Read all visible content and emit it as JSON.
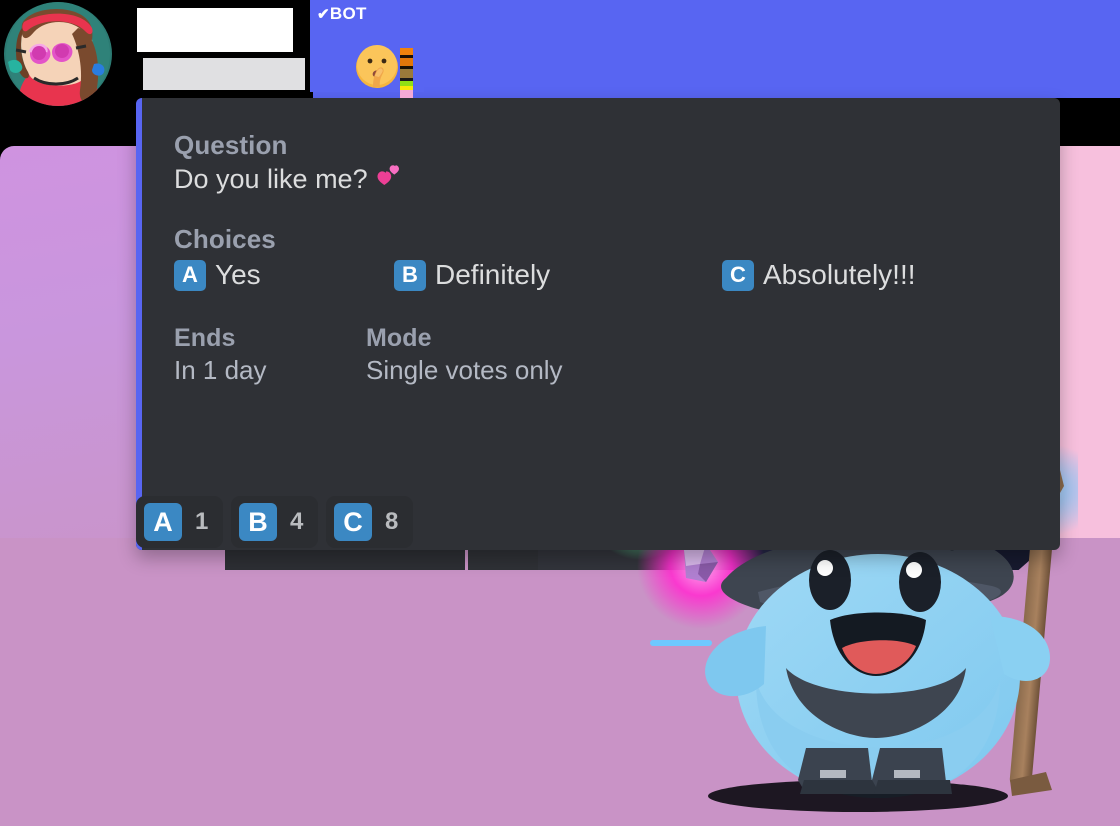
{
  "message": {
    "author_redacted": true,
    "bot_tag": "BOT",
    "bot_tag_check": "✔",
    "author_emoji": "shushing-face"
  },
  "embed": {
    "accent_color": "#5865f2",
    "background_color": "#2f3136",
    "fields": [
      {
        "name": "Question",
        "value": "Do you like me?",
        "emoji": "two-hearts"
      },
      {
        "name": "Choices",
        "value": ""
      },
      {
        "name": "Ends",
        "value": "In 1 day"
      },
      {
        "name": "Mode",
        "value": "Single votes only"
      }
    ],
    "question": {
      "name": "Question",
      "value": "Do you like me?",
      "emoji": "💕"
    },
    "choices": {
      "name": "Choices",
      "items": [
        {
          "letter": "A",
          "label": "Yes"
        },
        {
          "letter": "B",
          "label": "Definitely"
        },
        {
          "letter": "C",
          "label": "Absolutely!!!"
        }
      ]
    },
    "ends": {
      "name": "Ends",
      "value": "In 1 day"
    },
    "mode": {
      "name": "Mode",
      "value": "Single votes only"
    }
  },
  "reactions": [
    {
      "letter": "A",
      "count": "1"
    },
    {
      "letter": "B",
      "count": "4"
    },
    {
      "letter": "C",
      "count": "8"
    }
  ],
  "theme": {
    "blurple": "#5865f2",
    "regional_blue": "#3b88c3",
    "field_name_color": "#9aa0ae",
    "field_value_color": "#dcddde",
    "background_pink": "#f7c0dd",
    "background_mauve": "#c993c6"
  }
}
